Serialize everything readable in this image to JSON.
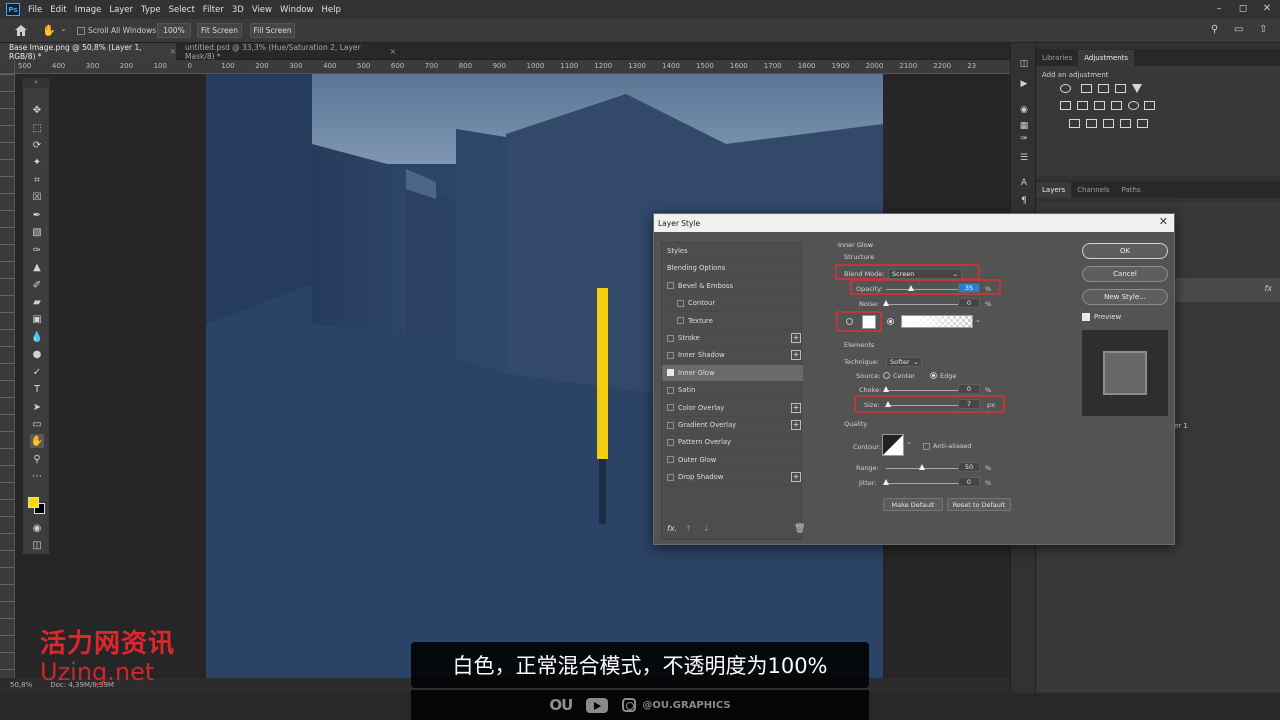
{
  "app": {
    "logo_text": "Ps",
    "menu": [
      "File",
      "Edit",
      "Image",
      "Layer",
      "Type",
      "Select",
      "Filter",
      "3D",
      "View",
      "Window",
      "Help"
    ]
  },
  "options_bar": {
    "scroll_all_windows": "Scroll All Windows",
    "zoom_value": "100%",
    "fit_screen": "Fit Screen",
    "fill_screen": "Fill Screen"
  },
  "tabs": [
    {
      "label": "Base Image.png @ 50,8% (Layer 1, RGB/8) *",
      "active": true
    },
    {
      "label": "untitled.psd @ 33,3% (Hue/Saturation 2, Layer Mask/8) *",
      "active": false
    }
  ],
  "ruler": {
    "h_labels": [
      "500",
      "400",
      "300",
      "200",
      "100",
      "0",
      "100",
      "200",
      "300",
      "400",
      "500",
      "600",
      "700",
      "800",
      "900",
      "1000",
      "1100",
      "1200",
      "1300",
      "1400",
      "1500",
      "1600",
      "1700",
      "1800",
      "1900",
      "2000",
      "2100",
      "2200",
      "23"
    ]
  },
  "status": {
    "zoom": "50,8%",
    "doc": "Doc: 4,39M/8,39M"
  },
  "right_panels": {
    "top_tabs": [
      "Libraries",
      "Adjustments"
    ],
    "active_top_tab": "Adjustments",
    "add_adjustment": "Add an adjustment",
    "layer_tabs": [
      "Layers",
      "Channels",
      "Paths"
    ],
    "active_layer_tab": "Layers",
    "fx_mark": "fx",
    "layer_name_partial": "er 1"
  },
  "dialog": {
    "title": "Layer Style",
    "styles": [
      {
        "label": "Styles",
        "checkbox": false,
        "checked": false,
        "plus": false,
        "indent": 0,
        "selected": false
      },
      {
        "label": "Blending Options",
        "checkbox": false,
        "checked": false,
        "plus": false,
        "indent": 0,
        "selected": false
      },
      {
        "label": "Bevel & Emboss",
        "checkbox": true,
        "checked": false,
        "plus": false,
        "indent": 0,
        "selected": false
      },
      {
        "label": "Contour",
        "checkbox": true,
        "checked": false,
        "plus": false,
        "indent": 1,
        "selected": false
      },
      {
        "label": "Texture",
        "checkbox": true,
        "checked": false,
        "plus": false,
        "indent": 1,
        "selected": false
      },
      {
        "label": "Stroke",
        "checkbox": true,
        "checked": false,
        "plus": true,
        "indent": 0,
        "selected": false
      },
      {
        "label": "Inner Shadow",
        "checkbox": true,
        "checked": false,
        "plus": true,
        "indent": 0,
        "selected": false
      },
      {
        "label": "Inner Glow",
        "checkbox": true,
        "checked": true,
        "plus": false,
        "indent": 0,
        "selected": true
      },
      {
        "label": "Satin",
        "checkbox": true,
        "checked": false,
        "plus": false,
        "indent": 0,
        "selected": false
      },
      {
        "label": "Color Overlay",
        "checkbox": true,
        "checked": false,
        "plus": true,
        "indent": 0,
        "selected": false
      },
      {
        "label": "Gradient Overlay",
        "checkbox": true,
        "checked": false,
        "plus": true,
        "indent": 0,
        "selected": false
      },
      {
        "label": "Pattern Overlay",
        "checkbox": true,
        "checked": false,
        "plus": false,
        "indent": 0,
        "selected": false
      },
      {
        "label": "Outer Glow",
        "checkbox": true,
        "checked": false,
        "plus": false,
        "indent": 0,
        "selected": false
      },
      {
        "label": "Drop Shadow",
        "checkbox": true,
        "checked": false,
        "plus": true,
        "indent": 0,
        "selected": false
      }
    ],
    "fx_label": "fx.",
    "section_title": "Inner Glow",
    "structure": {
      "title": "Structure",
      "blend_mode_label": "Blend Mode:",
      "blend_mode_value": "Screen",
      "opacity_label": "Opacity:",
      "opacity_value": "35",
      "opacity_level": 0.35,
      "noise_label": "Noise:",
      "noise_value": "0",
      "noise_level": 0,
      "percent": "%"
    },
    "elements": {
      "title": "Elements",
      "technique_label": "Technique:",
      "technique_value": "Softer",
      "source_label": "Source:",
      "source_center": "Center",
      "source_edge": "Edge",
      "source_selected": "Edge",
      "choke_label": "Choke:",
      "choke_value": "0",
      "choke_level": 0,
      "size_label": "Size:",
      "size_value": "7",
      "size_level": 0.03,
      "px": "px"
    },
    "quality": {
      "title": "Quality",
      "contour_label": "Contour:",
      "anti_aliased": "Anti-aliased",
      "range_label": "Range:",
      "range_value": "50",
      "range_level": 0.5,
      "jitter_label": "Jitter:",
      "jitter_value": "0",
      "jitter_level": 0
    },
    "make_default": "Make Default",
    "reset_to_default": "Reset to Default",
    "buttons": {
      "ok": "OK",
      "cancel": "Cancel",
      "new_style": "New Style...",
      "preview": "Preview"
    }
  },
  "overlay": {
    "watermark_cn": "活力网资讯",
    "watermark_en": "Uzing.net",
    "subtitle": "白色，正常混合模式，不透明度为100%",
    "channel_logo": "OU",
    "channel_handle": "@OU.GRAPHICS"
  },
  "colors": {
    "foreground": "#ffd700",
    "background": "#000000",
    "accent_red": "#b83a3a",
    "highlight": "#2d7dd2"
  }
}
